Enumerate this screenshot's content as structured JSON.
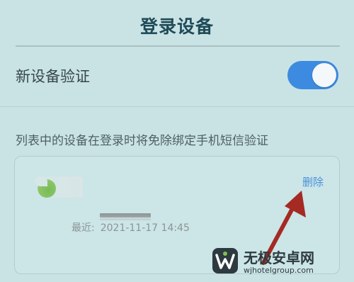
{
  "header": {
    "title": "登录设备"
  },
  "settings": {
    "new_device_verification": {
      "label": "新设备验证",
      "enabled": true
    }
  },
  "description": "列表中的设备在登录时将免除绑定手机短信验证",
  "devices": [
    {
      "icon": "device-icon",
      "name": "",
      "delete_label": "删除",
      "last_login_label": "最近:",
      "last_login_time": "2021-11-17 14:45"
    }
  ],
  "watermark": {
    "name": "无极安卓网",
    "url": "wjhotelgroup.com"
  },
  "colors": {
    "background": "#c9e3e5",
    "accent": "#3d8be0",
    "link": "#4a90d9",
    "arrow": "#a52a23",
    "title": "#1f4a57"
  }
}
